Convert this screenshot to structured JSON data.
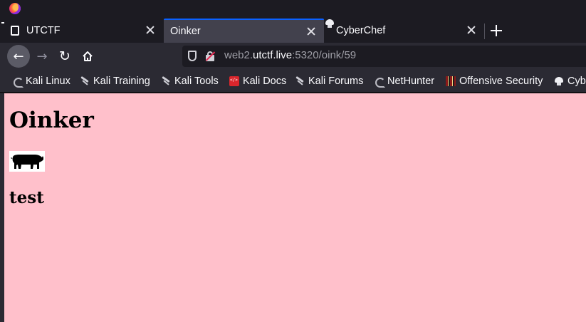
{
  "browser": {
    "tabs": [
      {
        "label": "UTCTF",
        "icon": "utctf-favicon-icon",
        "active": false
      },
      {
        "label": "Oinker",
        "icon": "",
        "active": true
      },
      {
        "label": "CyberChef",
        "icon": "chef-hat-icon",
        "active": false
      }
    ],
    "url": {
      "prefix": "web2.",
      "host": "utctf.live",
      "suffix": ":5320/oink/59"
    },
    "bookmarks": [
      {
        "label": "Kali Linux",
        "icon": "kali-dragon-icon"
      },
      {
        "label": "Kali Training",
        "icon": "kali-icon"
      },
      {
        "label": "Kali Tools",
        "icon": "kali-icon"
      },
      {
        "label": "Kali Docs",
        "icon": "kali-docs-icon"
      },
      {
        "label": "Kali Forums",
        "icon": "kali-icon"
      },
      {
        "label": "NetHunter",
        "icon": "kali-dragon-icon"
      },
      {
        "label": "Offensive Security",
        "icon": "offsec-icon"
      },
      {
        "label": "Cybe",
        "icon": "chef-hat-icon"
      }
    ]
  },
  "page": {
    "title": "Oinker",
    "image": "pig-image",
    "post": "test",
    "background": "#ffc0cb"
  },
  "colors": {
    "accent": "#0b61ff",
    "tab_active": "#42414d",
    "toolbar": "#2b2a33"
  }
}
